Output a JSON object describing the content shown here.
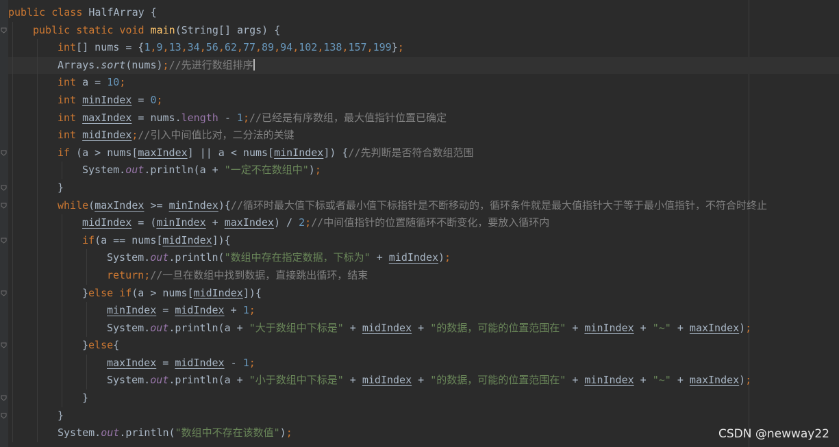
{
  "watermark": "CSDN @newway22",
  "lines": [
    [
      [
        "kw",
        "public class "
      ],
      [
        "id",
        "HalfArray "
      ],
      [
        "id",
        "{"
      ]
    ],
    [
      [
        "kw",
        "public static void "
      ],
      [
        "fn",
        "main"
      ],
      [
        "id",
        "(String[] args) {"
      ]
    ],
    [
      [
        "kw",
        "int"
      ],
      [
        "id",
        "[] nums = {"
      ],
      [
        "num",
        "1"
      ],
      [
        "kw",
        ","
      ],
      [
        "num",
        "9"
      ],
      [
        "kw",
        ","
      ],
      [
        "num",
        "13"
      ],
      [
        "kw",
        ","
      ],
      [
        "num",
        "34"
      ],
      [
        "kw",
        ","
      ],
      [
        "num",
        "56"
      ],
      [
        "kw",
        ","
      ],
      [
        "num",
        "62"
      ],
      [
        "kw",
        ","
      ],
      [
        "num",
        "77"
      ],
      [
        "kw",
        ","
      ],
      [
        "num",
        "89"
      ],
      [
        "kw",
        ","
      ],
      [
        "num",
        "94"
      ],
      [
        "kw",
        ","
      ],
      [
        "num",
        "102"
      ],
      [
        "kw",
        ","
      ],
      [
        "num",
        "138"
      ],
      [
        "kw",
        ","
      ],
      [
        "num",
        "157"
      ],
      [
        "kw",
        ","
      ],
      [
        "num",
        "199"
      ],
      [
        "id",
        "}"
      ],
      [
        "kw",
        ";"
      ]
    ],
    [
      [
        "id",
        "Arrays."
      ],
      [
        "ital",
        "sort"
      ],
      [
        "id",
        "(nums)"
      ],
      [
        "kw",
        ";"
      ],
      [
        "cmt",
        "//先进行数组排序"
      ]
    ],
    [
      [
        "kw",
        "int "
      ],
      [
        "id",
        "a = "
      ],
      [
        "num",
        "10"
      ],
      [
        "kw",
        ";"
      ]
    ],
    [
      [
        "kw",
        "int "
      ],
      [
        "id ul",
        "minIndex"
      ],
      [
        "id",
        " = "
      ],
      [
        "num",
        "0"
      ],
      [
        "kw",
        ";"
      ]
    ],
    [
      [
        "kw",
        "int "
      ],
      [
        "id ul",
        "maxIndex"
      ],
      [
        "id",
        " = nums."
      ],
      [
        "fld",
        "length"
      ],
      [
        "id",
        " - "
      ],
      [
        "num",
        "1"
      ],
      [
        "kw",
        ";"
      ],
      [
        "cmt",
        "//已经是有序数组，最大值指针位置已确定"
      ]
    ],
    [
      [
        "kw",
        "int "
      ],
      [
        "id ul",
        "midIndex"
      ],
      [
        "kw",
        ";"
      ],
      [
        "cmt",
        "//引入中间值比对，二分法的关键"
      ]
    ],
    [
      [
        "kw",
        "if "
      ],
      [
        "id",
        "(a > nums["
      ],
      [
        "id ul",
        "maxIndex"
      ],
      [
        "id",
        "] || a < nums["
      ],
      [
        "id ul",
        "minIndex"
      ],
      [
        "id",
        "]) {"
      ],
      [
        "cmt",
        "//先判断是否符合数组范围"
      ]
    ],
    [
      [
        "id",
        "System."
      ],
      [
        "stat",
        "out"
      ],
      [
        "id",
        ".println(a + "
      ],
      [
        "str",
        "\"一定不在数组中\""
      ],
      [
        "id",
        ")"
      ],
      [
        "kw",
        ";"
      ]
    ],
    [
      [
        "id",
        "}"
      ]
    ],
    [
      [
        "kw",
        "while"
      ],
      [
        "id",
        "("
      ],
      [
        "id ul",
        "maxIndex"
      ],
      [
        "id",
        " >= "
      ],
      [
        "id ul",
        "minIndex"
      ],
      [
        "id",
        ")"
      ],
      [
        "id",
        "{"
      ],
      [
        "cmt",
        "//循环时最大值下标或者最小值下标指针是不断移动的，循环条件就是最大值指针大于等于最小值指针，不符合时终止"
      ]
    ],
    [
      [
        "id ul",
        "midIndex"
      ],
      [
        "id",
        " = ("
      ],
      [
        "id ul",
        "minIndex"
      ],
      [
        "id",
        " + "
      ],
      [
        "id ul",
        "maxIndex"
      ],
      [
        "id",
        ") / "
      ],
      [
        "num",
        "2"
      ],
      [
        "kw",
        ";"
      ],
      [
        "cmt",
        "//中间值指针的位置随循环不断变化，要放入循环内"
      ]
    ],
    [
      [
        "kw",
        "if"
      ],
      [
        "id",
        "(a == nums["
      ],
      [
        "id ul",
        "midIndex"
      ],
      [
        "id",
        "])"
      ],
      [
        "id",
        "{"
      ]
    ],
    [
      [
        "id",
        "System."
      ],
      [
        "stat",
        "out"
      ],
      [
        "id",
        ".println("
      ],
      [
        "str",
        "\"数组中存在指定数据，下标为\""
      ],
      [
        "id",
        " + "
      ],
      [
        "id ul",
        "midIndex"
      ],
      [
        "id",
        ")"
      ],
      [
        "kw",
        ";"
      ]
    ],
    [
      [
        "kw",
        "return"
      ],
      [
        "kw",
        ";"
      ],
      [
        "cmt",
        "//一旦在数组中找到数据，直接跳出循环，结束"
      ]
    ],
    [
      [
        "id",
        "}"
      ],
      [
        "kw",
        "else if"
      ],
      [
        "id",
        "(a > nums["
      ],
      [
        "id ul",
        "midIndex"
      ],
      [
        "id",
        "])"
      ],
      [
        "id",
        "{"
      ]
    ],
    [
      [
        "id ul",
        "minIndex"
      ],
      [
        "id",
        " = "
      ],
      [
        "id ul",
        "midIndex"
      ],
      [
        "id",
        " + "
      ],
      [
        "num",
        "1"
      ],
      [
        "kw",
        ";"
      ]
    ],
    [
      [
        "id",
        "System."
      ],
      [
        "stat",
        "out"
      ],
      [
        "id",
        ".println(a + "
      ],
      [
        "str",
        "\"大于数组中下标是\""
      ],
      [
        "id",
        " + "
      ],
      [
        "id ul",
        "midIndex"
      ],
      [
        "id",
        " + "
      ],
      [
        "str",
        "\"的数据，可能的位置范围在\""
      ],
      [
        "id",
        " + "
      ],
      [
        "id ul",
        "minIndex"
      ],
      [
        "id",
        " + "
      ],
      [
        "str",
        "\"~\""
      ],
      [
        "id",
        " + "
      ],
      [
        "id ul",
        "maxIndex"
      ],
      [
        "id",
        ")"
      ],
      [
        "kw",
        ";"
      ]
    ],
    [
      [
        "id",
        "}"
      ],
      [
        "kw",
        "else"
      ],
      [
        "id",
        "{"
      ]
    ],
    [
      [
        "id ul",
        "maxIndex"
      ],
      [
        "id",
        " = "
      ],
      [
        "id ul",
        "midIndex"
      ],
      [
        "id",
        " - "
      ],
      [
        "num",
        "1"
      ],
      [
        "kw",
        ";"
      ]
    ],
    [
      [
        "id",
        "System."
      ],
      [
        "stat",
        "out"
      ],
      [
        "id",
        ".println(a + "
      ],
      [
        "str",
        "\"小于数组中下标是\""
      ],
      [
        "id",
        " + "
      ],
      [
        "id ul",
        "midIndex"
      ],
      [
        "id",
        " + "
      ],
      [
        "str",
        "\"的数据，可能的位置范围在\""
      ],
      [
        "id",
        " + "
      ],
      [
        "id ul",
        "minIndex"
      ],
      [
        "id",
        " + "
      ],
      [
        "str",
        "\"~\""
      ],
      [
        "id",
        " + "
      ],
      [
        "id ul",
        "maxIndex"
      ],
      [
        "id",
        ")"
      ],
      [
        "kw",
        ";"
      ]
    ],
    [
      [
        "id",
        "}"
      ]
    ],
    [
      [
        "id",
        "}"
      ]
    ],
    [
      [
        "id",
        "System."
      ],
      [
        "stat",
        "out"
      ],
      [
        "id",
        ".println("
      ],
      [
        "str",
        "\"数组中不存在该数值\""
      ],
      [
        "id",
        ")"
      ],
      [
        "kw",
        ";"
      ]
    ]
  ]
}
